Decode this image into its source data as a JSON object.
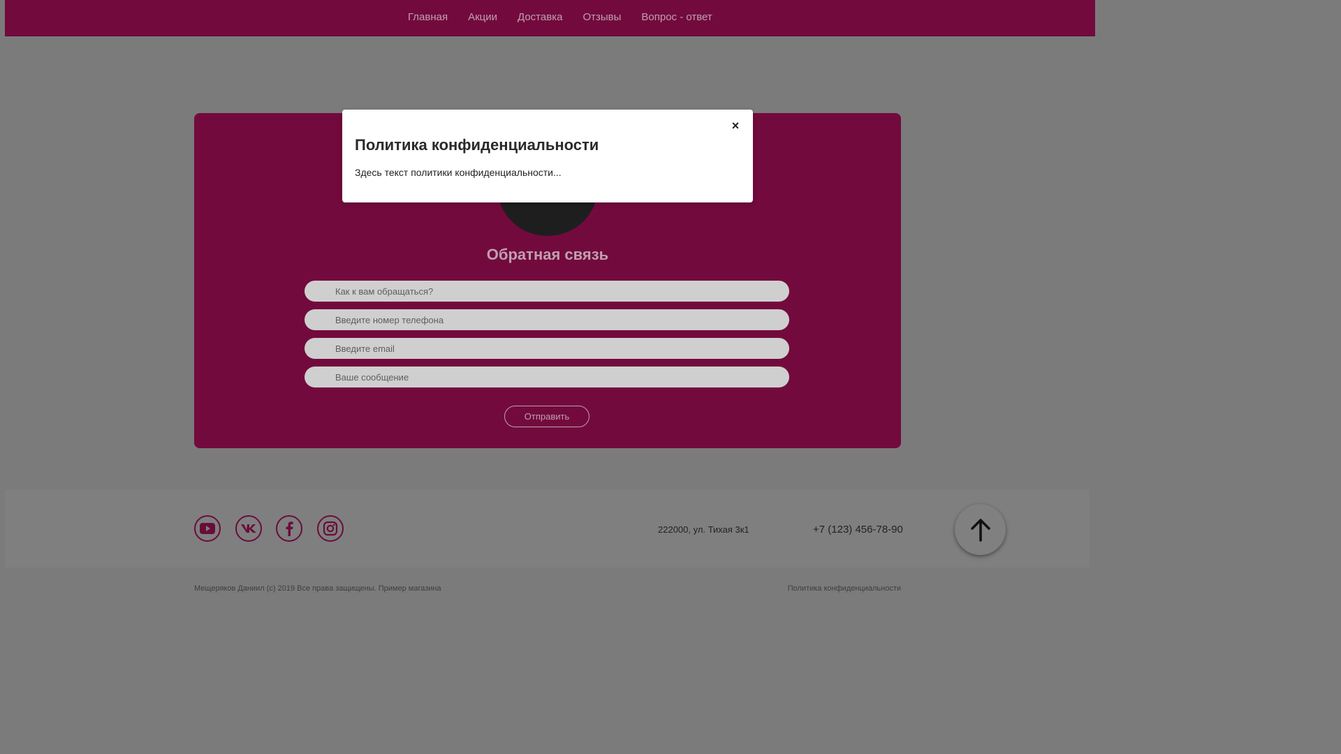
{
  "nav": {
    "items": [
      {
        "label": "Главная"
      },
      {
        "label": "Акции"
      },
      {
        "label": "Доставка"
      },
      {
        "label": "Отзывы"
      },
      {
        "label": "Вопрос - ответ"
      }
    ]
  },
  "feedback": {
    "title": "Обратная связь",
    "fields": {
      "name_placeholder": "Как к вам обращаться?",
      "phone_placeholder": "Введите номер телефона",
      "email_placeholder": "Введите email",
      "message_placeholder": "Ваше сообщение"
    },
    "submit_label": "Отправить"
  },
  "footer": {
    "social": [
      "youtube-icon",
      "vk-icon",
      "facebook-icon",
      "instagram-icon"
    ],
    "address": "222000, ул. Тихая 3к1",
    "phone": "+7 (123) 456-78-90",
    "copyright": "Мещеряков Даниил (c) 2019 Все права защищены. Пример магазина",
    "policy_link": "Политика конфиденциальности"
  },
  "modal": {
    "title": "Политика конфиденциальности",
    "text": "Здесь текст политики конфиденциальности...",
    "close_symbol": "×"
  },
  "colors": {
    "brand": "#730a3e",
    "overlay": "#7b7b7b",
    "accent_text": "#bfa0ae"
  }
}
